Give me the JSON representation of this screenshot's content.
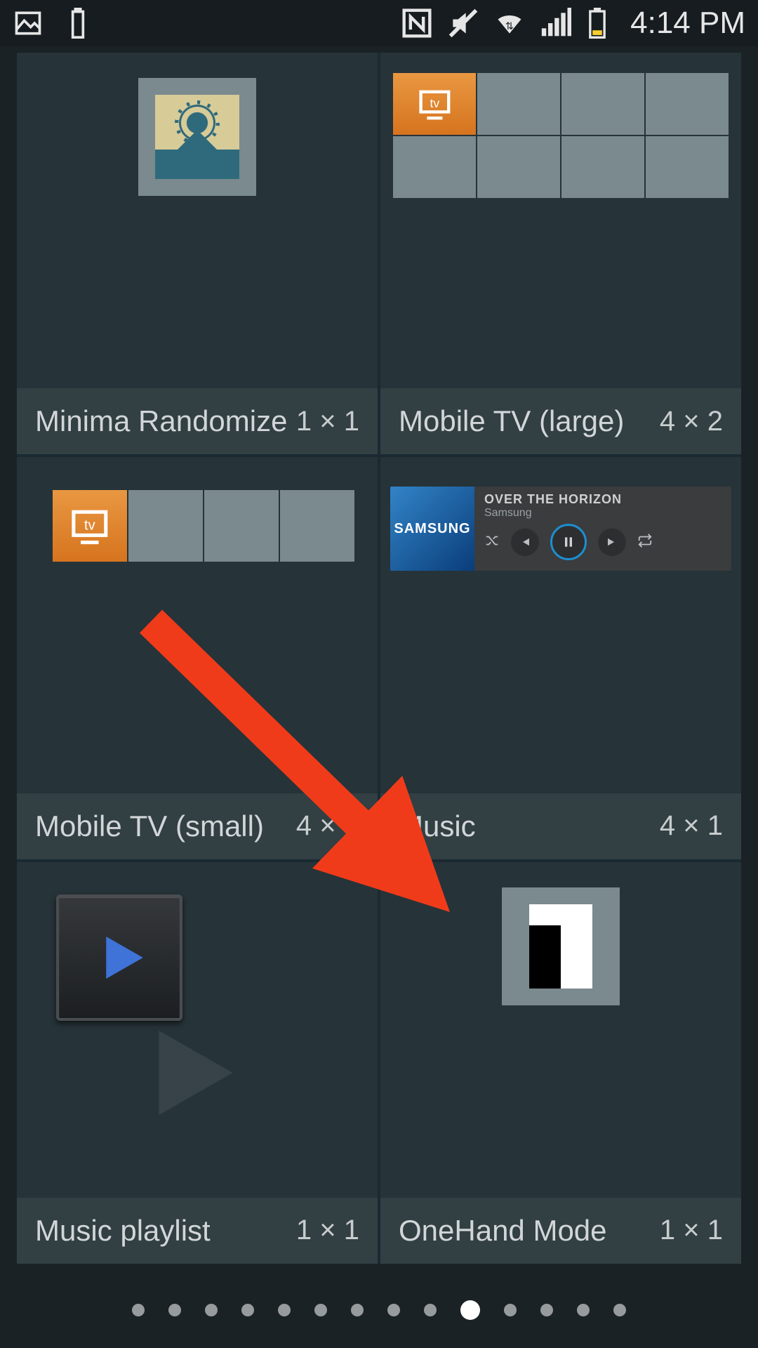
{
  "status": {
    "clock": "4:14 PM"
  },
  "widgets": [
    {
      "name": "Minima Randomize",
      "size": "1 × 1"
    },
    {
      "name": "Mobile TV (large)",
      "size": "4 × 2"
    },
    {
      "name": "Mobile TV (small)",
      "size": "4 × 1"
    },
    {
      "name": "Music",
      "size": "4 × 1"
    },
    {
      "name": "Music playlist",
      "size": "1 × 1"
    },
    {
      "name": "OneHand Mode",
      "size": "1 × 1"
    }
  ],
  "music_preview": {
    "brand": "SAMSUNG",
    "title": "OVER THE HORIZON",
    "artist": "Samsung"
  },
  "pager": {
    "total": 14,
    "active": 9
  }
}
